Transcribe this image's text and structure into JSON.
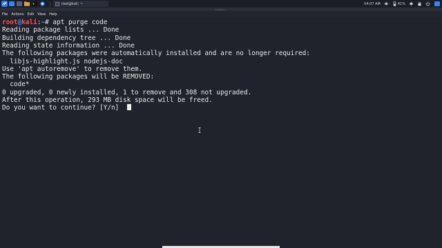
{
  "panel": {
    "taskbar_title": "root@kali: ~",
    "clock": "04:07 AM",
    "battery": "41%"
  },
  "window": {
    "title": "root@kali: ~"
  },
  "menu": {
    "items": [
      "File",
      "Actions",
      "Edit",
      "View",
      "Help"
    ]
  },
  "terminal": {
    "prompt_user": "root",
    "prompt_at": "@",
    "prompt_host": "kali",
    "prompt_sep": ":",
    "prompt_path": "~",
    "prompt_hash": "# ",
    "command": "apt purge code",
    "output": [
      "Reading package lists ... Done",
      "Building dependency tree ... Done",
      "Reading state information ... Done",
      "The following packages were automatically installed and are no longer required:",
      "  libjs-highlight.js nodejs-doc",
      "Use 'apt autoremove' to remove them.",
      "The following packages will be REMOVED:",
      "  code*",
      "0 upgraded, 0 newly installed, 1 to remove and 308 not upgraded.",
      "After this operation, 293 MB disk space will be freed."
    ],
    "question": "Do you want to continue? [Y/n] "
  },
  "colors": {
    "background": "#20232b",
    "prompt_red": "#ff4f4f",
    "prompt_blue": "#4f8cff",
    "accent": "#3b82f6"
  },
  "icons": [
    "kali-dragon-icon",
    "file-manager-icon",
    "terminal-icon",
    "browser-icon",
    "volume-icon",
    "battery-icon",
    "bell-icon",
    "lock-icon",
    "power-icon"
  ]
}
